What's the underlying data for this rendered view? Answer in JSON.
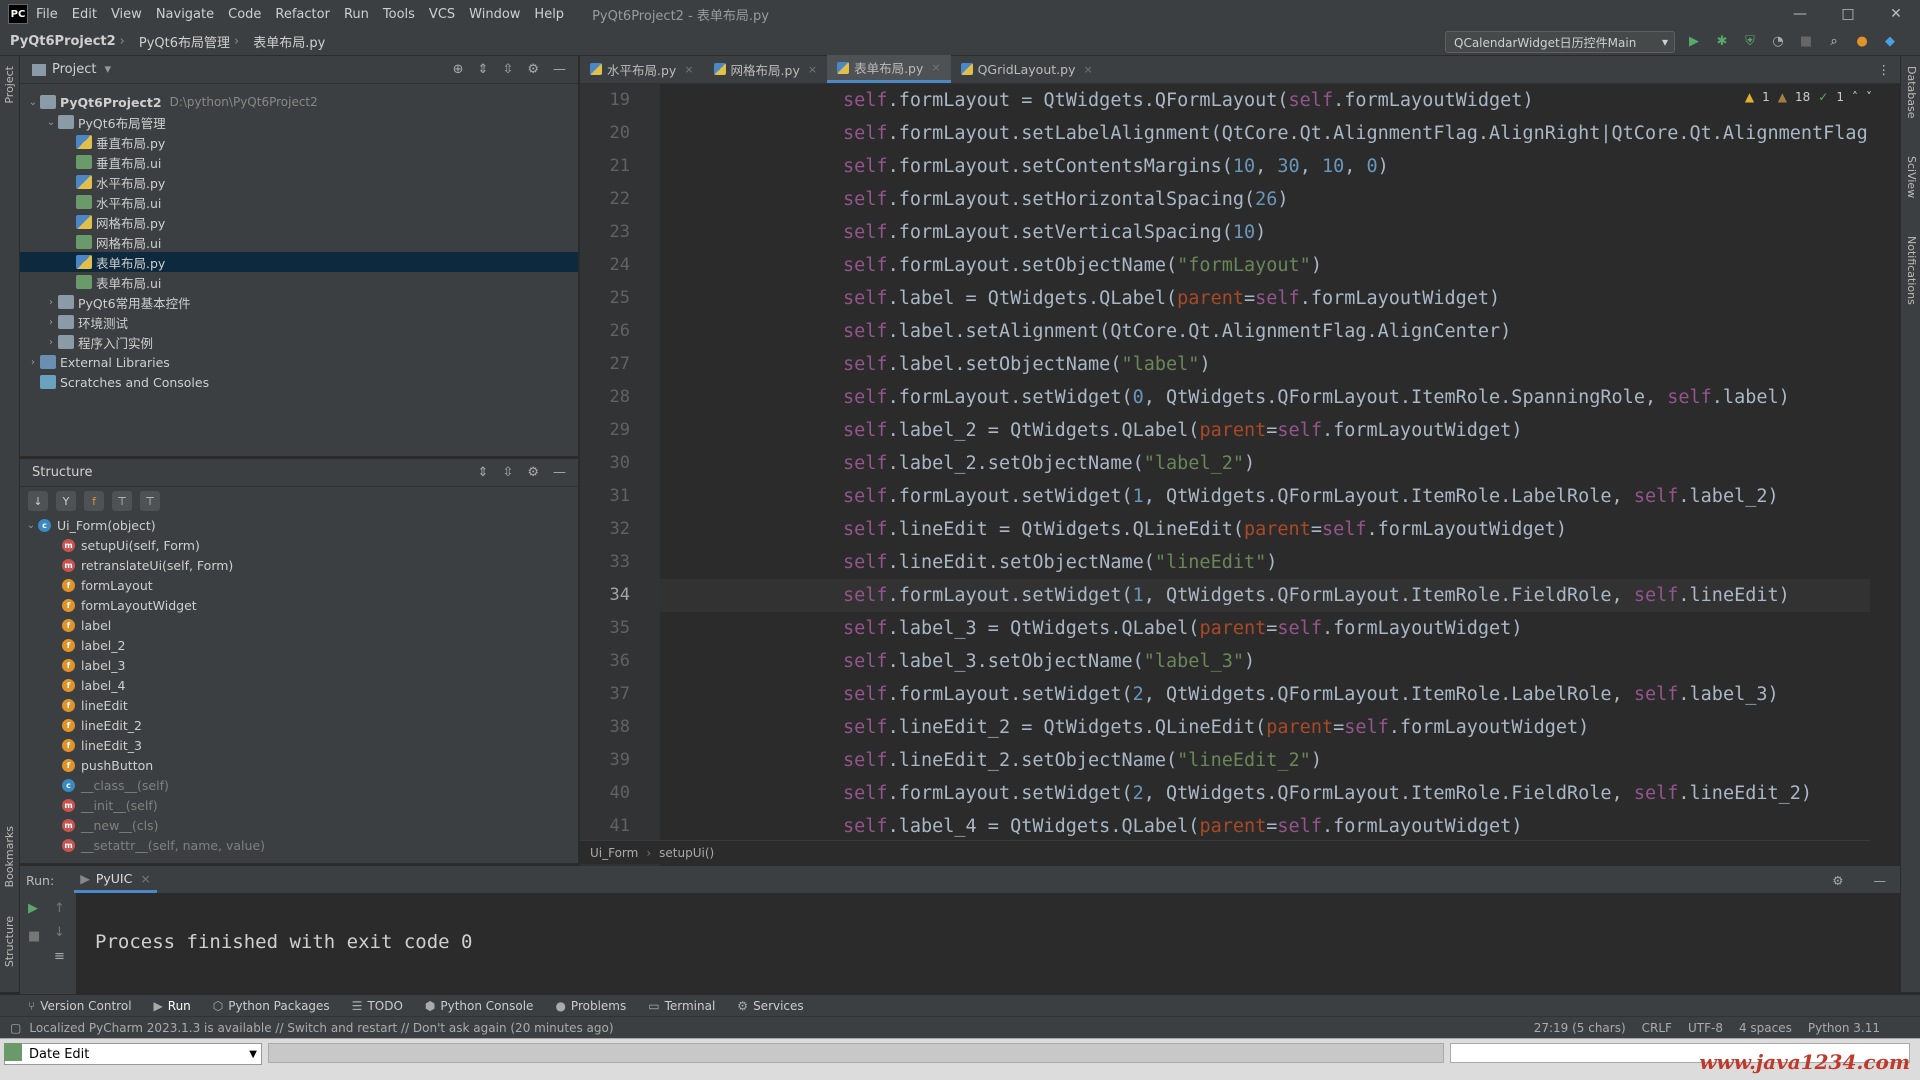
{
  "window": {
    "menu": [
      "File",
      "Edit",
      "View",
      "Navigate",
      "Code",
      "Refactor",
      "Run",
      "Tools",
      "VCS",
      "Window",
      "Help"
    ],
    "title": "PyQt6Project2 - 表单布局.py",
    "logo": "PC"
  },
  "breadcrumb": [
    "PyQt6Project2",
    "PyQt6布局管理",
    "表单布局.py"
  ],
  "run_config": "QCalendarWidget日历控件Main",
  "left_strip": {
    "project": "Project",
    "bookmarks": "Bookmarks",
    "structure": "Structure"
  },
  "right_strip": {
    "database": "Database",
    "sciview": "SciView",
    "notifications": "Notifications"
  },
  "project_panel": {
    "title": "Project",
    "items": [
      {
        "label": "PyQt6Project2",
        "path": "D:\\python\\PyQt6Project2",
        "level": 0,
        "type": "folder",
        "bold": true
      },
      {
        "label": "PyQt6布局管理",
        "level": 1,
        "type": "folder"
      },
      {
        "label": "垂直布局.py",
        "level": 2,
        "type": "py"
      },
      {
        "label": "垂直布局.ui",
        "level": 2,
        "type": "ui"
      },
      {
        "label": "水平布局.py",
        "level": 2,
        "type": "py"
      },
      {
        "label": "水平布局.ui",
        "level": 2,
        "type": "ui"
      },
      {
        "label": "网格布局.py",
        "level": 2,
        "type": "py"
      },
      {
        "label": "网格布局.ui",
        "level": 2,
        "type": "ui"
      },
      {
        "label": "表单布局.py",
        "level": 2,
        "type": "py",
        "selected": true
      },
      {
        "label": "表单布局.ui",
        "level": 2,
        "type": "ui"
      },
      {
        "label": "PyQt6常用基本控件",
        "level": 1,
        "type": "folder",
        "collapsed": true
      },
      {
        "label": "环境测试",
        "level": 1,
        "type": "folder",
        "collapsed": true
      },
      {
        "label": "程序入门实例",
        "level": 1,
        "type": "folder",
        "collapsed": true
      },
      {
        "label": "External Libraries",
        "level": 0,
        "type": "lib",
        "collapsed": true
      },
      {
        "label": "Scratches and Consoles",
        "level": 0,
        "type": "scr"
      }
    ]
  },
  "structure_panel": {
    "title": "Structure",
    "root": "Ui_Form(object)",
    "members": [
      {
        "label": "setupUi(self, Form)",
        "kind": "m"
      },
      {
        "label": "retranslateUi(self, Form)",
        "kind": "m"
      },
      {
        "label": "formLayout",
        "kind": "f"
      },
      {
        "label": "formLayoutWidget",
        "kind": "f"
      },
      {
        "label": "label",
        "kind": "f"
      },
      {
        "label": "label_2",
        "kind": "f"
      },
      {
        "label": "label_3",
        "kind": "f"
      },
      {
        "label": "label_4",
        "kind": "f"
      },
      {
        "label": "lineEdit",
        "kind": "f"
      },
      {
        "label": "lineEdit_2",
        "kind": "f"
      },
      {
        "label": "lineEdit_3",
        "kind": "f"
      },
      {
        "label": "pushButton",
        "kind": "f"
      },
      {
        "label": "__class__(self)",
        "kind": "c",
        "dim": true
      },
      {
        "label": "__init__(self)",
        "kind": "m",
        "dim": true
      },
      {
        "label": "__new__(cls)",
        "kind": "m",
        "dim": true
      },
      {
        "label": "__setattr__(self, name, value)",
        "kind": "m",
        "dim": true
      }
    ]
  },
  "editor": {
    "tabs": [
      "水平布局.py",
      "网格布局.py",
      "表单布局.py",
      "QGridLayout.py"
    ],
    "active_tab": 2,
    "inspection": {
      "warn_a": "1",
      "warn_b": "18",
      "ok": "1"
    },
    "current_line": 34,
    "lines": [
      {
        "n": "19",
        "code": "self.formLayout = QtWidgets.QFormLayout(self.formLayoutWidget)"
      },
      {
        "n": "20",
        "code": "self.formLayout.setLabelAlignment(QtCore.Qt.AlignmentFlag.AlignRight|QtCore.Qt.AlignmentFlag.A"
      },
      {
        "n": "21",
        "code": "self.formLayout.setContentsMargins(10, 30, 10, 0)"
      },
      {
        "n": "22",
        "code": "self.formLayout.setHorizontalSpacing(26)"
      },
      {
        "n": "23",
        "code": "self.formLayout.setVerticalSpacing(10)"
      },
      {
        "n": "24",
        "code": "self.formLayout.setObjectName(\"formLayout\")"
      },
      {
        "n": "25",
        "code": "self.label = QtWidgets.QLabel(parent=self.formLayoutWidget)"
      },
      {
        "n": "26",
        "code": "self.label.setAlignment(QtCore.Qt.AlignmentFlag.AlignCenter)"
      },
      {
        "n": "27",
        "code": "self.label.setObjectName(\"label\")"
      },
      {
        "n": "28",
        "code": "self.formLayout.setWidget(0, QtWidgets.QFormLayout.ItemRole.SpanningRole, self.label)"
      },
      {
        "n": "29",
        "code": "self.label_2 = QtWidgets.QLabel(parent=self.formLayoutWidget)"
      },
      {
        "n": "30",
        "code": "self.label_2.setObjectName(\"label_2\")"
      },
      {
        "n": "31",
        "code": "self.formLayout.setWidget(1, QtWidgets.QFormLayout.ItemRole.LabelRole, self.label_2)"
      },
      {
        "n": "32",
        "code": "self.lineEdit = QtWidgets.QLineEdit(parent=self.formLayoutWidget)"
      },
      {
        "n": "33",
        "code": "self.lineEdit.setObjectName(\"lineEdit\")"
      },
      {
        "n": "34",
        "code": "self.formLayout.setWidget(1, QtWidgets.QFormLayout.ItemRole.FieldRole, self.lineEdit)"
      },
      {
        "n": "35",
        "code": "self.label_3 = QtWidgets.QLabel(parent=self.formLayoutWidget)"
      },
      {
        "n": "36",
        "code": "self.label_3.setObjectName(\"label_3\")"
      },
      {
        "n": "37",
        "code": "self.formLayout.setWidget(2, QtWidgets.QFormLayout.ItemRole.LabelRole, self.label_3)"
      },
      {
        "n": "38",
        "code": "self.lineEdit_2 = QtWidgets.QLineEdit(parent=self.formLayoutWidget)"
      },
      {
        "n": "39",
        "code": "self.lineEdit_2.setObjectName(\"lineEdit_2\")"
      },
      {
        "n": "40",
        "code": "self.formLayout.setWidget(2, QtWidgets.QFormLayout.ItemRole.FieldRole, self.lineEdit_2)"
      },
      {
        "n": "41",
        "code": "self.label_4 = QtWidgets.QLabel(parent=self.formLayoutWidget)"
      }
    ],
    "breadcrumb": [
      "Ui_Form",
      "setupUi()"
    ]
  },
  "run_panel": {
    "label": "Run:",
    "tab": "PyUIC",
    "output": "Process finished with exit code 0"
  },
  "bottom_tools": [
    "Version Control",
    "Run",
    "Python Packages",
    "TODO",
    "Python Console",
    "Problems",
    "Terminal",
    "Services"
  ],
  "status": {
    "message": "Localized PyCharm 2023.1.3 is available // Switch and restart // Don't ask again (20 minutes ago)",
    "position": "27:19 (5 chars)",
    "line_sep": "CRLF",
    "encoding": "UTF-8",
    "indent": "4 spaces",
    "interpreter": "Python 3.11"
  },
  "qt_window": {
    "dropdown": "Date Edit"
  },
  "watermark": "www.java1234.com"
}
